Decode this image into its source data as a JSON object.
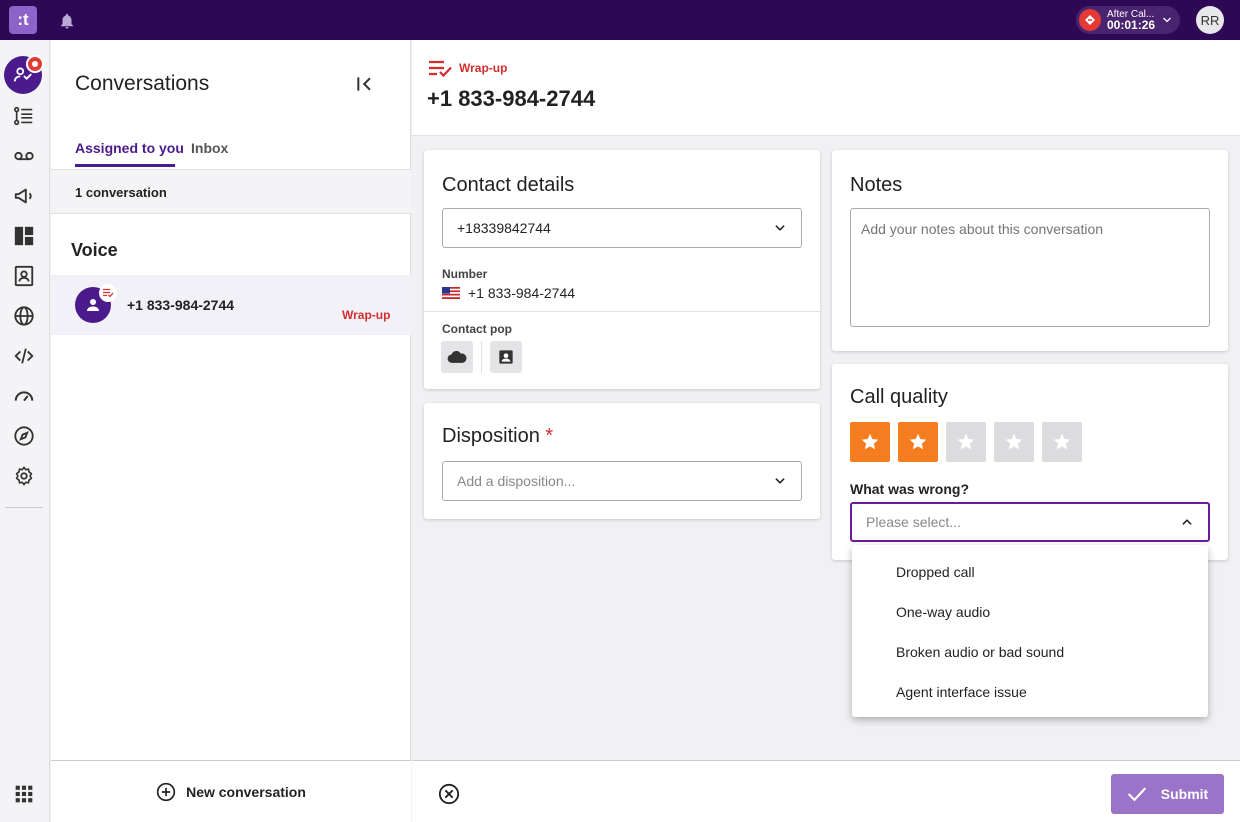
{
  "topbar": {
    "logo_text": ":t",
    "status": {
      "label": "After Cal...",
      "timer": "00:01:26",
      "color": "#e53935"
    },
    "user_initials": "RR"
  },
  "rail": {
    "icons": [
      "conversations-icon",
      "tasks-list-icon",
      "voicemail-icon",
      "campaigns-icon",
      "dashboard-icon",
      "contacts-icon",
      "globe-icon",
      "code-icon",
      "performance-gauge-icon",
      "explore-compass-icon",
      "settings-gear-icon",
      "apps-grid-icon"
    ]
  },
  "conversations": {
    "title": "Conversations",
    "tabs": [
      {
        "label": "Assigned to you",
        "active": true
      },
      {
        "label": "Inbox",
        "active": false
      }
    ],
    "count_label": "1 conversation",
    "section": "Voice",
    "items": [
      {
        "number": "+1 833-984-2744",
        "status": "Wrap-up"
      }
    ],
    "new_label": "New conversation"
  },
  "main": {
    "status": "Wrap-up",
    "number": "+1 833-984-2744"
  },
  "contact": {
    "title": "Contact details",
    "selected": "+18339842744",
    "number_label": "Number",
    "number_value": "+1 833-984-2744",
    "pop_label": "Contact pop"
  },
  "disposition": {
    "title": "Disposition",
    "required_mark": "*",
    "placeholder": "Add a disposition..."
  },
  "notes": {
    "title": "Notes",
    "placeholder": "Add your notes about this conversation"
  },
  "quality": {
    "title": "Call quality",
    "rating": 2,
    "max_rating": 5,
    "wrong_label": "What was wrong?",
    "select_placeholder": "Please select...",
    "options": [
      "Dropped call",
      "One-way audio",
      "Broken audio or bad sound",
      "Agent interface issue"
    ]
  },
  "footer": {
    "submit_label": "Submit"
  },
  "colors": {
    "topbar": "#2e0854",
    "brand": "#4b1a8c",
    "alert": "#d32f2f",
    "star_on": "#f57c1f",
    "submit": "#9b73c8"
  }
}
